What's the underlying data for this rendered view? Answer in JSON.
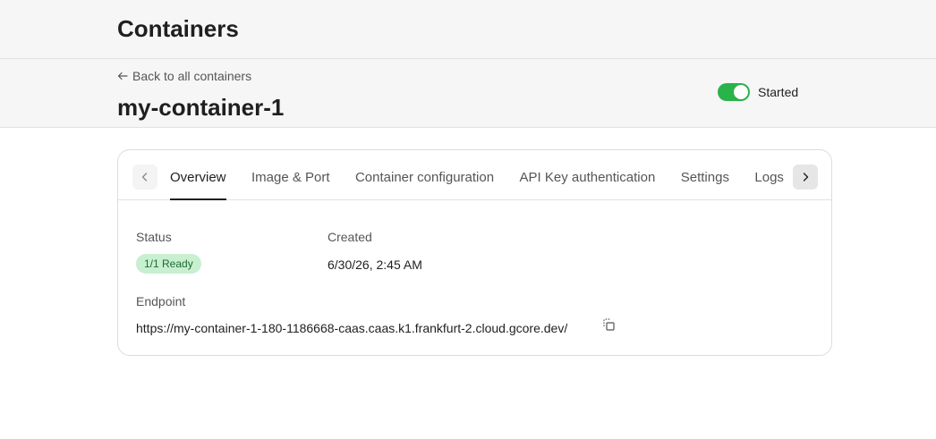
{
  "header": {
    "title": "Containers"
  },
  "subheader": {
    "back_label": "Back to all containers",
    "container_name": "my-container-1",
    "toggle_label": "Started",
    "toggle_on": true
  },
  "tabs": [
    {
      "label": "Overview",
      "active": true
    },
    {
      "label": "Image & Port",
      "active": false
    },
    {
      "label": "Container configuration",
      "active": false
    },
    {
      "label": "API Key authentication",
      "active": false
    },
    {
      "label": "Settings",
      "active": false
    },
    {
      "label": "Logs",
      "active": false
    }
  ],
  "overview": {
    "status_label": "Status",
    "status_value": "1/1 Ready",
    "created_label": "Created",
    "created_value": "6/30/26, 2:45 AM",
    "endpoint_label": "Endpoint",
    "endpoint_value": "https://my-container-1-180-1186668-caas.caas.k1.frankfurt-2.cloud.gcore.dev/"
  },
  "colors": {
    "toggle_on": "#2ab24b",
    "badge_bg": "#c8efd0",
    "badge_text": "#1e6b32"
  },
  "icons": {
    "back": "arrow-left-icon",
    "scroll_left": "chevron-left-icon",
    "scroll_right": "chevron-right-icon",
    "copy": "copy-icon"
  }
}
